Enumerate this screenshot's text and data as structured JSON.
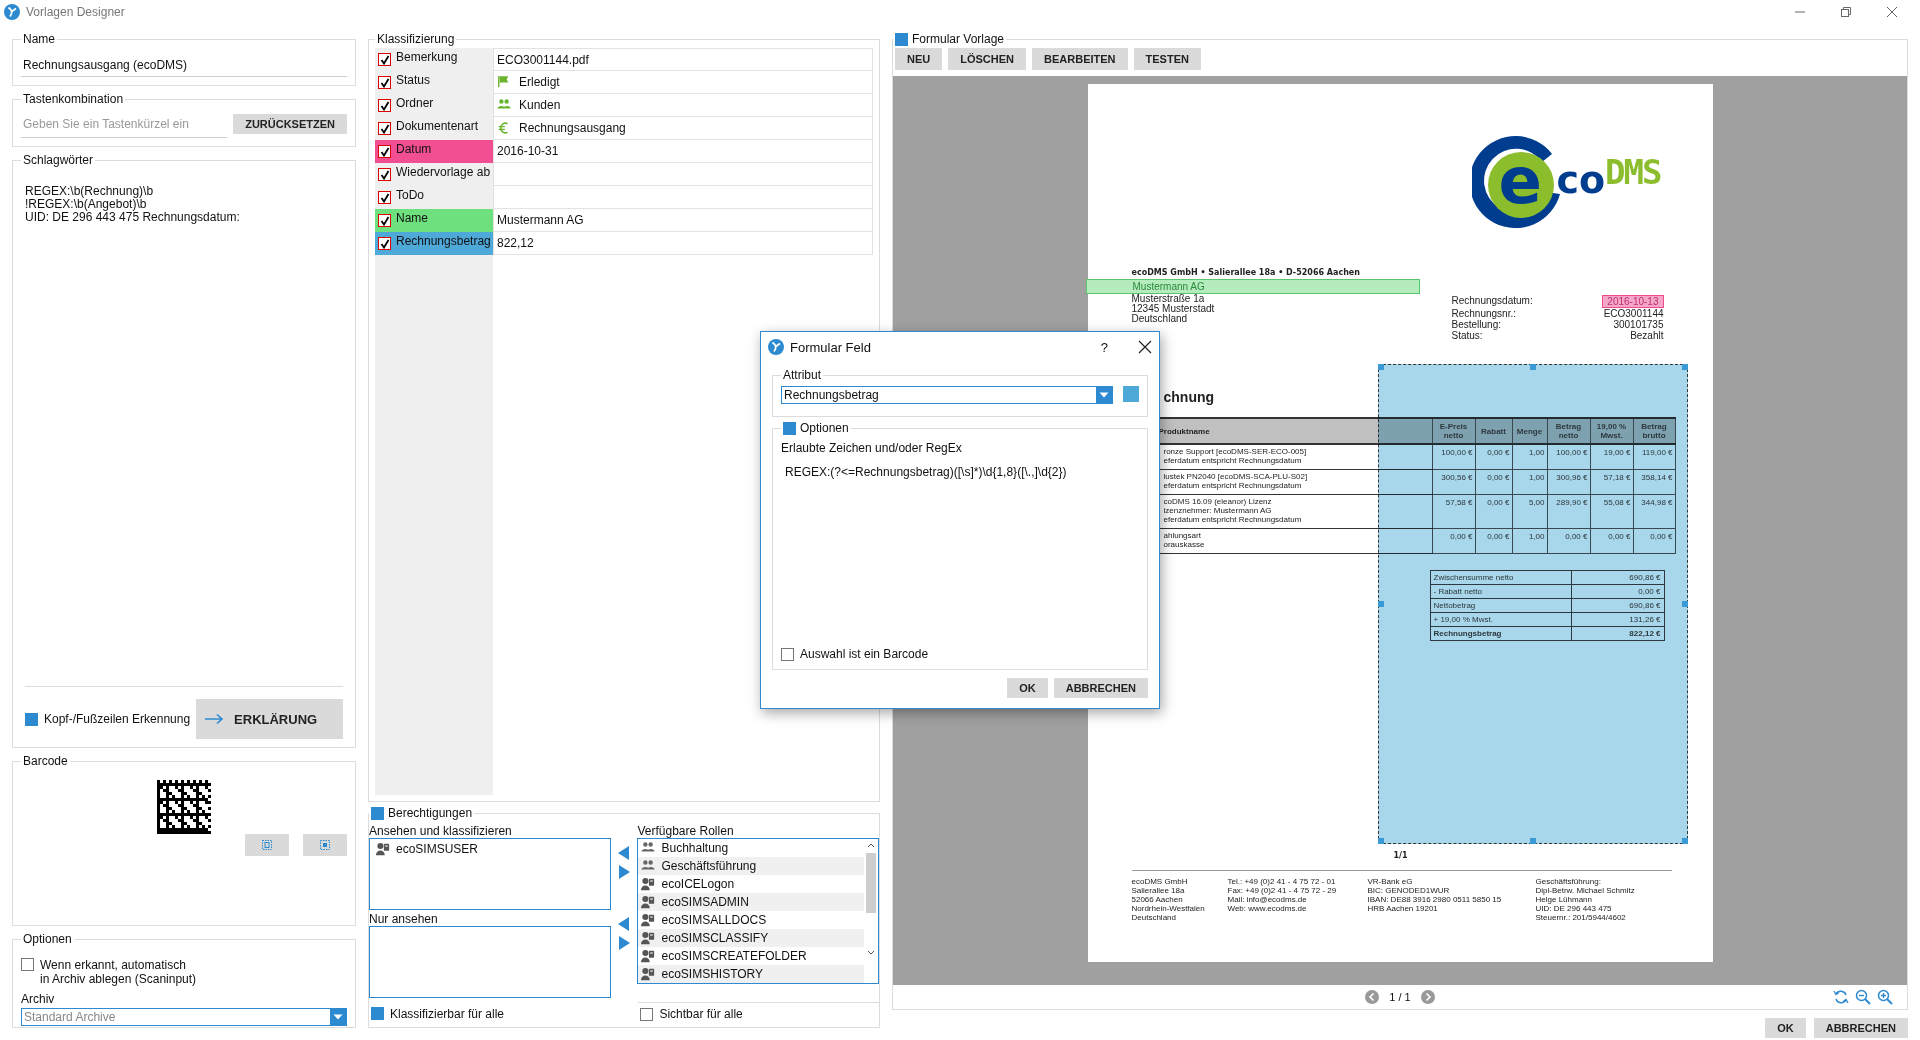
{
  "window": {
    "title": "Vorlagen Designer"
  },
  "left": {
    "name": {
      "label": "Name",
      "value": "Rechnungsausgang (ecoDMS)"
    },
    "shortcut": {
      "label": "Tastenkombination",
      "placeholder": "Geben Sie ein Tastenkürzel ein",
      "button": "ZURÜCKSETZEN"
    },
    "keywords": {
      "label": "Schlagwörter",
      "lines": [
        "REGEX:\\b(Rechnung)\\b",
        "!REGEX:\\b(Angebot)\\b",
        "UID: DE 296 443 475 Rechnungsdatum:"
      ]
    },
    "header_footer": {
      "label": "Kopf-/Fußzeilen Erkennung",
      "checked": true
    },
    "explain_button": "ERKLÄRUNG",
    "barcode": {
      "label": "Barcode"
    },
    "options": {
      "label": "Optionen",
      "auto_archive": {
        "label": "Wenn erkannt, automatisch\nin Archiv ablegen (Scaninput)",
        "checked": false
      },
      "archive": {
        "label": "Archiv",
        "value": "Standard Archive"
      }
    }
  },
  "classification": {
    "label": "Klassifizierung",
    "rows": [
      {
        "label": "Bemerkung",
        "checked": true,
        "kind": "text",
        "value": "ECO3001144.pdf"
      },
      {
        "label": "Status",
        "checked": true,
        "kind": "status",
        "value": "Erledigt"
      },
      {
        "label": "Ordner",
        "checked": true,
        "kind": "folder",
        "value": "Kunden"
      },
      {
        "label": "Dokumentenart",
        "checked": true,
        "kind": "doctype",
        "value": "Rechnungsausgang"
      },
      {
        "label": "Datum",
        "checked": true,
        "kind": "text",
        "value": "2016-10-31",
        "color": "#f24f93"
      },
      {
        "label": "Wiedervorlage ab",
        "checked": true,
        "kind": "text"
      },
      {
        "label": "ToDo",
        "checked": true,
        "kind": "text"
      },
      {
        "label": "Name",
        "checked": true,
        "kind": "text",
        "value": "Mustermann AG",
        "color": "#6ee07e"
      },
      {
        "label": "Rechnungsbetrag",
        "checked": true,
        "kind": "text",
        "value": "822,12",
        "color": "#4ea9d9"
      }
    ]
  },
  "permissions": {
    "label": "Berechtigungen",
    "checked": true,
    "view_classify": {
      "label": "Ansehen und klassifizieren",
      "items": [
        {
          "name": "ecoSIMSUSER",
          "kind": "user"
        }
      ]
    },
    "view_only": {
      "label": "Nur ansehen"
    },
    "available_roles": {
      "label": "Verfügbare Rollen",
      "items": [
        {
          "name": "Buchhaltung",
          "kind": "group"
        },
        {
          "name": "Geschäftsführung",
          "kind": "group"
        },
        {
          "name": "ecoICELogon",
          "kind": "user"
        },
        {
          "name": "ecoSIMSADMIN",
          "kind": "user"
        },
        {
          "name": "ecoSIMSALLDOCS",
          "kind": "user"
        },
        {
          "name": "ecoSIMSCLASSIFY",
          "kind": "user"
        },
        {
          "name": "ecoSIMSCREATEFOLDER",
          "kind": "user"
        },
        {
          "name": "ecoSIMSHISTORY",
          "kind": "user"
        }
      ]
    },
    "classify_all": {
      "label": "Klassifizierbar für alle",
      "checked": true
    },
    "visible_all": {
      "label": "Sichtbar für alle",
      "checked": false
    }
  },
  "form_template": {
    "label": "Formular Vorlage",
    "checked": true,
    "buttons": [
      "NEU",
      "LÖSCHEN",
      "BEARBEITEN",
      "TESTEN"
    ]
  },
  "document": {
    "logo": [
      "e",
      "co",
      "DMS"
    ],
    "sender_line": "ecoDMS GmbH • Salierallee 18a • D-52066 Aachen",
    "address": [
      {
        "text": "Mustermann AG",
        "color": "#b4ecbe"
      },
      {
        "text": "Musterstraße 1a"
      },
      {
        "text": "12345 Musterstadt"
      },
      {
        "text": "Deutschland"
      }
    ],
    "info": [
      {
        "label": "Rechnungsdatum:",
        "value": "2016-10-13",
        "color": "#f3a6c8"
      },
      {
        "label": "Rechnungsnr.:",
        "value": "ECO3001144"
      },
      {
        "label": "Bestellung:",
        "value": "300101735"
      },
      {
        "label": "Status:",
        "value": "Bezahlt"
      }
    ],
    "heading": "chnung",
    "table": {
      "columns": [
        "Produktname",
        "",
        "E-Preis netto",
        "Rabatt",
        "Menge",
        "Betrag netto",
        "19,00 % Mwst.",
        "Betrag brutto"
      ],
      "rows": [
        {
          "notes": [
            "eferdatum entspricht Rechnungsdatum"
          ],
          "cells": [
            "ronze Support [ecoDMS-SER-ECO-005]",
            "",
            "100,00 €",
            "0,00 €",
            "1,00",
            "100,00 €",
            "19,00 €",
            "119,00 €"
          ]
        },
        {
          "notes": [
            "eferdatum entspricht Rechnungsdatum"
          ],
          "cells": [
            "lustek PN2040 [ecoDMS-SCA-PLU-S02]",
            "",
            "300,56 €",
            "0,00 €",
            "1,00",
            "300,96 €",
            "57,18 €",
            "358,14 €"
          ]
        },
        {
          "notes": [
            "izenznehmer: Mustermann AG",
            "eferdatum entspricht Rechnungsdatum"
          ],
          "cells": [
            "coDMS 16.09 (eleanor) Lizenz",
            "",
            "57,58 €",
            "0,00 €",
            "5,00",
            "289,90 €",
            "55,08 €",
            "344,98 €"
          ]
        },
        {
          "notes": [
            "orauskasse"
          ],
          "cells": [
            "ahlungsart",
            "",
            "0,00 €",
            "0,00 €",
            "1,00",
            "0,00 €",
            "0,00 €",
            "0,00 €"
          ]
        }
      ]
    },
    "totals": [
      {
        "label": "Zwischensumme netto",
        "value": "690,86 €",
        "bold": false
      },
      {
        "label": "- Rabatt netto",
        "value": "0,00 €",
        "bold": false
      },
      {
        "label": "Nettobetrag",
        "value": "690,86 €",
        "bold": false
      },
      {
        "label": "+ 19,00 % Mwst.",
        "value": "131,26 €",
        "bold": false
      },
      {
        "label": "Rechnungsbetrag",
        "value": "822,12 €",
        "bold": true
      }
    ],
    "selection": {
      "color": "#a8d6ea"
    },
    "page_number": "1/1",
    "footer": [
      [
        "ecoDMS GmbH",
        "Salierallee 18a",
        "52066 Aachen",
        "Nordrhein-Westfalen",
        "Deutschland"
      ],
      [
        "Tel.: +49 (0)2 41 - 4 75 72 - 01",
        "Fax: +49 (0)2 41 - 4 75 72 - 29",
        "Mail: info@ecodms.de",
        "Web: www.ecodms.de"
      ],
      [
        "VR-Bank eG",
        "BIC: GENODED1WUR",
        "IBAN: DE88 3916 2980 0511 5850 15",
        "HRB Aachen 19201"
      ],
      [
        "Geschäftsführung:",
        "Dipl-Betrw. Michael Schmitz",
        "Helge Lühmann",
        "UID: DE 296 443 475",
        "Steuernr.: 201/5944/4602"
      ]
    ]
  },
  "pager": {
    "text": "1 / 1"
  },
  "buttons": [
    "OK",
    "ABBRECHEN"
  ],
  "dialog": {
    "title": "Formular Feld",
    "help": "?",
    "attribute": {
      "label": "Attribut",
      "value": "Rechnungsbetrag",
      "color": "#4ea9d9"
    },
    "options": {
      "label": "Optionen",
      "checked": true,
      "hint": "Erlaubte Zeichen und/oder RegEx",
      "regex": "REGEX:(?<=Rechnungsbetrag)([\\s]*)\\d{1,8}([\\.,]\\d{2})",
      "barcode": {
        "label": "Auswahl ist ein Barcode",
        "checked": false
      }
    },
    "buttons": [
      "OK",
      "ABBRECHEN"
    ]
  }
}
